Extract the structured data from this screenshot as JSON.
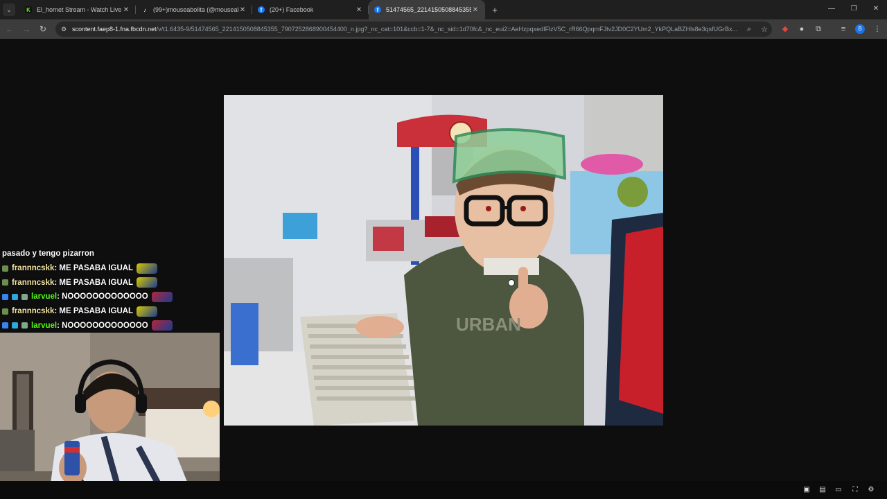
{
  "browser": {
    "tabs": [
      {
        "title": "El_hornet Stream - Watch Live o",
        "favicon": "kick-icon",
        "favicon_color": "#53fc18",
        "active": false
      },
      {
        "title": "(99+)mouseabolita (@mouseab",
        "favicon": "tiktok-icon",
        "favicon_color": "#ffffff",
        "active": false
      },
      {
        "title": "(20+) Facebook",
        "favicon": "facebook-icon",
        "favicon_color": "#1877f2",
        "active": false
      },
      {
        "title": "51474565_2214150508845355_",
        "favicon": "facebook-icon",
        "favicon_color": "#1877f2",
        "active": true
      }
    ],
    "url_host": "scontent.faep8-1.fna.fbcdn.net",
    "url_path": "/v/t1.6435-9/51474565_2214150508845355_7907252868900454400_n.jpg?_nc_cat=101&ccb=1-7&_nc_sid=1d70fc&_nc_eui2=AeHzpqxedIFlzV5C_rR66QpqmFJtv2JD0C2YUm2_YkPQLaBZHls8e3qsfUGrBx...",
    "profile_initial": "B"
  },
  "chat": {
    "messages": [
      {
        "user": "",
        "text": "pasado y tengo pizarron",
        "user_color": "#ffffff",
        "emote_color": null,
        "badges": []
      },
      {
        "user": "frannncskk",
        "text": " : ME PASABA IGUAL",
        "user_color": "#f3e6a3",
        "emote_color": "#d8c800",
        "badges": [
          "#6b8e4e"
        ]
      },
      {
        "user": "frannncskk",
        "text": " : ME PASABA IGUAL",
        "user_color": "#f3e6a3",
        "emote_color": "#d8c800",
        "badges": [
          "#6b8e4e"
        ]
      },
      {
        "user": "larvuel",
        "text": " : NOOOOOOOOOOOOO",
        "user_color": "#53fc18",
        "emote_color": "#b3263a",
        "badges": [
          "#3b82f6",
          "#2ea8e0",
          "#7fa88f"
        ]
      },
      {
        "user": "frannncskk",
        "text": " : ME PASABA IGUAL",
        "user_color": "#f3e6a3",
        "emote_color": "#d8c800",
        "badges": [
          "#6b8e4e"
        ]
      },
      {
        "user": "larvuel",
        "text": " : NOOOOOOOOOOOOO",
        "user_color": "#53fc18",
        "emote_color": "#b3263a",
        "badges": [
          "#3b82f6",
          "#2ea8e0",
          "#7fa88f"
        ]
      }
    ]
  },
  "player_controls": [
    "picture-in-picture-icon",
    "theater-icon",
    "miniplayer-icon",
    "fullscreen-icon",
    "settings-icon"
  ]
}
